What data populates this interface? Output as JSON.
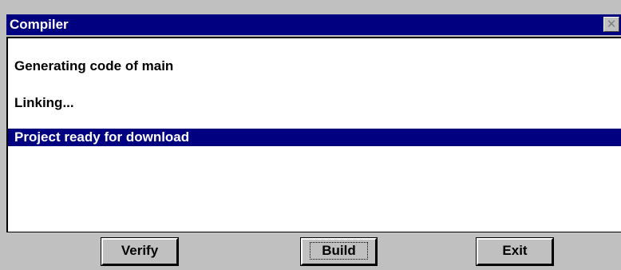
{
  "window": {
    "title": "Compiler",
    "close_glyph": "✕"
  },
  "log": {
    "lines": [
      {
        "text": "Generating code of main",
        "selected": false
      },
      {
        "text": "Linking...",
        "selected": false
      },
      {
        "text": "Project ready for download",
        "selected": true
      }
    ]
  },
  "buttons": {
    "verify": "Verify",
    "build": "Build",
    "exit": "Exit"
  },
  "colors": {
    "titlebar": "#000080",
    "selection": "#000080",
    "face": "#c0c0c0"
  },
  "icons": {
    "close": "close-icon"
  }
}
